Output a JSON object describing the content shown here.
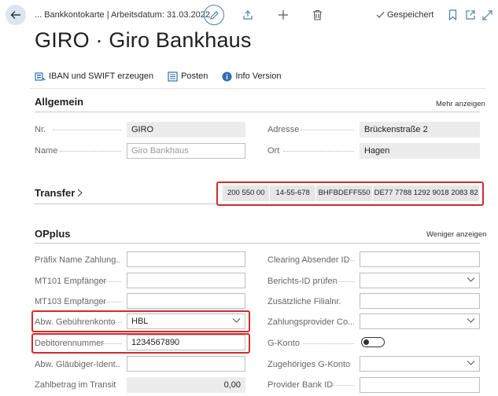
{
  "header": {
    "breadcrumb": "... Bankkontokarte | Arbeitsdatum: 31.03.2022",
    "saved_status": "Gespeichert",
    "page_title": "GIRO · Giro Bankhaus"
  },
  "actions": [
    {
      "label": "IBAN und SWIFT erzeugen",
      "icon": "generate-icon"
    },
    {
      "label": "Posten",
      "icon": "entries-icon"
    },
    {
      "label": "Info Version",
      "icon": "info-icon"
    }
  ],
  "allgemein": {
    "title": "Allgemein",
    "link": "Mehr anzeigen",
    "left": [
      {
        "label": "Nr.",
        "value": "GIRO"
      },
      {
        "label": "Name",
        "value": "Giro Bankhaus"
      }
    ],
    "right": [
      {
        "label": "Adresse",
        "value": "Brückenstraße 2"
      },
      {
        "label": "Ort",
        "value": "Hagen"
      }
    ]
  },
  "transfer": {
    "title": "Transfer",
    "values": [
      "200 550 00",
      "14-55-678",
      "BHFBDEFF550",
      "DE77 7788 1292 9018 2083 82"
    ]
  },
  "opplus": {
    "title": "OPplus",
    "link": "Weniger anzeigen",
    "left": [
      {
        "label": "Präfix Name Zahlung...",
        "value": ""
      },
      {
        "label": "MT101 Empfänger",
        "value": ""
      },
      {
        "label": "MT103 Empfänger",
        "value": ""
      },
      {
        "label": "Abw. Gebührenkonto",
        "value": "HBL"
      },
      {
        "label": "Debitorennummer",
        "value": "1234567890"
      },
      {
        "label": "Abw. Gläubiger-Ident...",
        "value": ""
      },
      {
        "label": "Zahlbetrag im Transit",
        "value": "0,00"
      }
    ],
    "right": [
      {
        "label": "Clearing Absender ID",
        "value": ""
      },
      {
        "label": "Berichts-ID prüfen",
        "value": ""
      },
      {
        "label": "Zusätzliche Filialnr.",
        "value": ""
      },
      {
        "label": "Zahlungsprovider Co...",
        "value": ""
      },
      {
        "label": "G-Konto",
        "value": ""
      },
      {
        "label": "Zugehöriges G-Konto",
        "value": ""
      },
      {
        "label": "Provider Bank ID",
        "value": ""
      }
    ]
  },
  "colors": {
    "highlight": "#d12b2b",
    "accent": "#4a7fb0"
  }
}
